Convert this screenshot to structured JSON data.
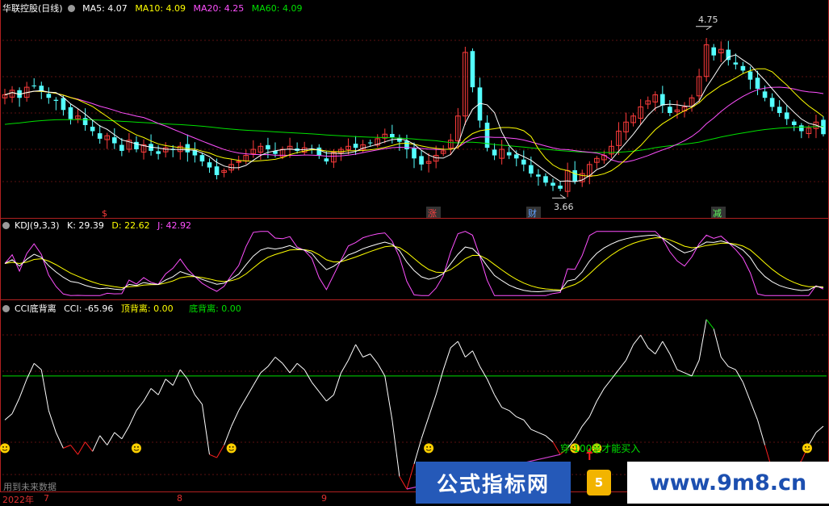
{
  "main_legend": {
    "stock": "华联控股(日线)",
    "ma5": "MA5: 4.07",
    "ma10": "MA10: 4.09",
    "ma20": "MA20: 4.25",
    "ma60": "MA60: 4.09"
  },
  "kdj_legend": {
    "name": "KDJ(9,3,3)",
    "k": "K: 29.39",
    "d": "D: 22.62",
    "j": "J: 42.92"
  },
  "cci_legend": {
    "name": "CCI底背离",
    "cci": "CCI: -65.96",
    "top": "顶背离: 0.00",
    "bottom": "底背离: 0.00"
  },
  "annotations": {
    "high": "4.75",
    "low": "3.66",
    "marker_1": "$",
    "marker_zhang": "涨",
    "marker_cai": "财",
    "marker_jian": "减",
    "hint": "穿-100是才能买入"
  },
  "footer": {
    "note": "用到未来数据",
    "year": "2022年",
    "m7": "7",
    "m8": "8",
    "m9": "9"
  },
  "watermark": {
    "left": "公式指标网",
    "badge": "5",
    "right": "www.9m8.cn"
  },
  "colors": {
    "up": "#ff3c3c",
    "down": "#54ffff",
    "ma5": "#ffffff",
    "ma10": "#ffff00",
    "ma20": "#ff50ff",
    "ma60": "#00e000",
    "cci_line": "#ffffff",
    "cci_low": "#ff2020",
    "cci_high": "#00e000",
    "divider": "#b02020"
  },
  "chart_data": [
    {
      "type": "candlestick",
      "title": "华联控股(日线)",
      "ylim": [
        3.55,
        4.85
      ],
      "high_label": 4.75,
      "low_label": 3.66,
      "closes": [
        4.32,
        4.35,
        4.3,
        4.37,
        4.38,
        4.34,
        4.3,
        4.28,
        4.22,
        4.16,
        4.18,
        4.12,
        4.08,
        4.03,
        4.05,
        4.0,
        3.95,
        4.02,
        3.96,
        3.99,
        3.95,
        3.93,
        3.97,
        3.96,
        3.98,
        3.94,
        3.92,
        3.88,
        3.84,
        3.79,
        3.82,
        3.86,
        3.88,
        3.92,
        3.96,
        3.98,
        3.96,
        3.93,
        3.96,
        3.98,
        3.95,
        3.97,
        3.96,
        3.92,
        3.88,
        3.94,
        3.96,
        3.98,
        3.97,
        3.99,
        4.0,
        4.03,
        4.06,
        4.04,
        4.01,
        3.96,
        3.9,
        3.86,
        3.88,
        3.92,
        3.95,
        4.02,
        4.18,
        4.6,
        4.37,
        4.15,
        3.97,
        3.92,
        3.96,
        3.92,
        3.9,
        3.86,
        3.8,
        3.78,
        3.74,
        3.72,
        3.7,
        3.82,
        3.75,
        3.8,
        3.86,
        3.9,
        3.92,
        3.98,
        4.08,
        4.14,
        4.18,
        4.24,
        4.28,
        4.32,
        4.25,
        4.2,
        4.22,
        4.24,
        4.3,
        4.44,
        4.65,
        4.58,
        4.62,
        4.55,
        4.52,
        4.48,
        4.42,
        4.36,
        4.3,
        4.24,
        4.2,
        4.16,
        4.12,
        4.08,
        4.1,
        4.14,
        4.06
      ],
      "series": [
        {
          "name": "MA5",
          "value": 4.07
        },
        {
          "name": "MA10",
          "value": 4.09
        },
        {
          "name": "MA20",
          "value": 4.25
        },
        {
          "name": "MA60",
          "value": 4.09
        }
      ]
    },
    {
      "type": "line",
      "title": "KDJ(9,3,3)",
      "ylim": [
        0,
        100
      ],
      "series": [
        {
          "name": "K",
          "value": 29.39
        },
        {
          "name": "D",
          "value": 22.62
        },
        {
          "name": "J",
          "value": 42.92
        }
      ]
    },
    {
      "type": "line",
      "title": "CCI底背离",
      "ylim": [
        -260,
        300
      ],
      "reference_line": 100,
      "values": [
        -40,
        -20,
        30,
        90,
        140,
        120,
        -10,
        -80,
        -130,
        -120,
        -150,
        -110,
        -140,
        -90,
        -120,
        -80,
        -100,
        -60,
        -10,
        20,
        60,
        40,
        90,
        70,
        120,
        90,
        40,
        10,
        -150,
        -160,
        -120,
        -60,
        -10,
        30,
        70,
        110,
        130,
        160,
        140,
        110,
        140,
        120,
        80,
        50,
        20,
        40,
        110,
        150,
        200,
        160,
        170,
        140,
        100,
        -40,
        -220,
        -260,
        -180,
        -100,
        -30,
        40,
        120,
        190,
        210,
        160,
        180,
        130,
        90,
        40,
        0,
        -10,
        -30,
        -40,
        -70,
        -80,
        -90,
        -110,
        -150,
        -130,
        -100,
        -60,
        -30,
        20,
        60,
        90,
        120,
        150,
        200,
        230,
        190,
        170,
        210,
        170,
        120,
        110,
        100,
        150,
        280,
        250,
        160,
        130,
        120,
        80,
        20,
        -40,
        -120,
        -200,
        -230,
        -200,
        -190,
        -170,
        -120,
        -80,
        -60
      ],
      "series": [
        {
          "name": "CCI",
          "value": -65.96
        },
        {
          "name": "顶背离",
          "value": 0.0
        },
        {
          "name": "底背离",
          "value": 0.0
        }
      ]
    }
  ]
}
